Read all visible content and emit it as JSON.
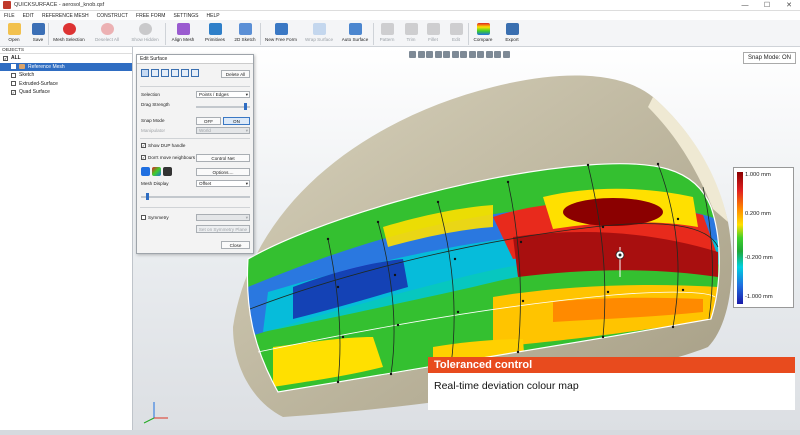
{
  "window": {
    "title": "QUICKSURFACE - aerosol_knob.qsf",
    "minimize": "—",
    "maximize": "☐",
    "close": "✕"
  },
  "menu": [
    "FILE",
    "EDIT",
    "REFERENCE MESH",
    "CONSTRUCT",
    "FREE FORM",
    "SETTINGS",
    "HELP"
  ],
  "toolbar": {
    "open": "Open",
    "save": "Save",
    "mesh_selection": "Mesh Selection",
    "deselect_all": "Deselect All",
    "show_hidden": "Show Hidden",
    "align_mesh": "Align Mesh",
    "primitives": "Primitives",
    "sketch_2d": "2D Sketch",
    "new_free_form": "New Free Form",
    "wrap_surface": "Wrap Surface",
    "auto_surface": "Auto Surface",
    "pattern": "Pattern",
    "trim": "Trim",
    "fillet": "Fillet",
    "edit": "Edit",
    "compare": "Compare",
    "export": "Export"
  },
  "objects": {
    "header": "OBJECTS",
    "items": [
      {
        "label": "ALL",
        "checked": "✓"
      },
      {
        "label": "Reference Mesh",
        "checked": "✓"
      },
      {
        "label": "Sketch",
        "checked": ""
      },
      {
        "label": "Extruded-Surface",
        "checked": ""
      },
      {
        "label": "Quad Surface",
        "checked": "✓"
      }
    ]
  },
  "snap_mode_badge": "Snap Mode: ON",
  "edit_surface": {
    "title": "Edit Surface",
    "delete_all": "Delete All",
    "selection_label": "Selection",
    "selection_value": "Points / Edges",
    "drag_strength_label": "Drag Strength",
    "drag_strength_level": 0.95,
    "snap_mode_label": "Snap Mode",
    "snap_off": "OFF",
    "snap_on": "ON",
    "manipulator_label": "Manipulator",
    "manipulator_value": "World",
    "show_dup_handle": "Show DUP handle",
    "dont_move_neighbours": "Don't move neighbours",
    "control_net": "Control Net",
    "options": "Options....",
    "mesh_display_label": "Mesh Display",
    "mesh_display_value": "Offset",
    "mesh_display_level": 0.05,
    "symmetry": "Symmetry",
    "set_symmetry_plane": "Set on Symmetry Plane",
    "close": "Close",
    "checkmark": "✓"
  },
  "legend": {
    "labels": [
      "1.000 mm",
      "0.200 mm",
      "-0.200 mm",
      "-1.000 mm"
    ]
  },
  "banner": {
    "title": "Toleranced control",
    "subtitle": "Real-time deviation colour map"
  },
  "colors": {
    "accent": "#e84b1e",
    "selection": "#2f6dc2",
    "mesh": "#c9c2aa"
  }
}
